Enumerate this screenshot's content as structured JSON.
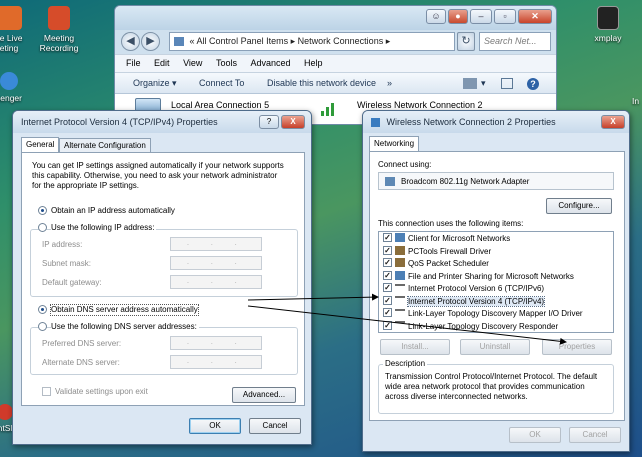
{
  "desktop": {
    "icons": [
      {
        "label": "ce Live\neting",
        "color": "#e06a2a"
      },
      {
        "label": "Meeting\nRecording",
        "color": "#d64c2a"
      },
      {
        "label": "xmplay",
        "color": "#222222"
      },
      {
        "label": "senger",
        "color": "#3a8ad8"
      },
      {
        "label": "In",
        "color": ""
      },
      {
        "label": "ntSl",
        "color": "#d03a2a"
      }
    ]
  },
  "explorer": {
    "address_parts": [
      "«",
      "All Control Panel Items",
      "▸",
      "Network Connections",
      "▸"
    ],
    "search_placeholder": "Search Net...",
    "menu": [
      "File",
      "Edit",
      "View",
      "Tools",
      "Advanced",
      "Help"
    ],
    "commands": [
      "Organize ▾",
      "Connect To",
      "Disable this network device",
      "»"
    ],
    "connections": [
      "Local Area Connection 5",
      "Wireless Network Connection 2"
    ]
  },
  "ipv4": {
    "title": "Internet Protocol Version 4 (TCP/IPv4) Properties",
    "tabs": [
      "General",
      "Alternate Configuration"
    ],
    "intro": [
      "You can get IP settings assigned automatically if your network supports",
      "this capability. Otherwise, you need to ask your network administrator",
      "for the appropriate IP settings."
    ],
    "obtain_ip": "Obtain an IP address automatically",
    "use_ip": "Use the following IP address:",
    "ip_fields": [
      "IP address:",
      "Subnet mask:",
      "Default gateway:"
    ],
    "obtain_dns": "Obtain DNS server address automatically",
    "use_dns": "Use the following DNS server addresses:",
    "dns_fields": [
      "Preferred DNS server:",
      "Alternate DNS server:"
    ],
    "validate": "Validate settings upon exit",
    "advanced": "Advanced...",
    "ok": "OK",
    "cancel": "Cancel",
    "help_glyph": "?",
    "close_glyph": "X"
  },
  "wireless": {
    "title": "Wireless Network Connection 2 Properties",
    "tab": "Networking",
    "connect_using": "Connect using:",
    "adapter": "Broadcom 802.11g Network Adapter",
    "configure": "Configure...",
    "items_label": "This connection uses the following items:",
    "items": [
      {
        "label": "Client for Microsoft Networks",
        "icon": "client-icon"
      },
      {
        "label": "PCTools Firewall Driver",
        "icon": "driver-icon"
      },
      {
        "label": "QoS Packet Scheduler",
        "icon": "driver-icon"
      },
      {
        "label": "File and Printer Sharing for Microsoft Networks",
        "icon": "client-icon"
      },
      {
        "label": "Internet Protocol Version 6 (TCP/IPv6)",
        "icon": "protocol-icon"
      },
      {
        "label": "Internet Protocol Version 4 (TCP/IPv4)",
        "icon": "protocol-icon"
      },
      {
        "label": "Link-Layer Topology Discovery Mapper I/O Driver",
        "icon": "protocol-icon"
      },
      {
        "label": "Link-Layer Topology Discovery Responder",
        "icon": "protocol-icon"
      }
    ],
    "install": "Install...",
    "uninstall": "Uninstall",
    "properties": "Properties",
    "description_label": "Description",
    "description": [
      "Transmission Control Protocol/Internet Protocol. The default",
      "wide area network protocol that provides communication",
      "across diverse interconnected networks."
    ],
    "ok": "OK",
    "cancel": "Cancel",
    "close_glyph": "X"
  }
}
